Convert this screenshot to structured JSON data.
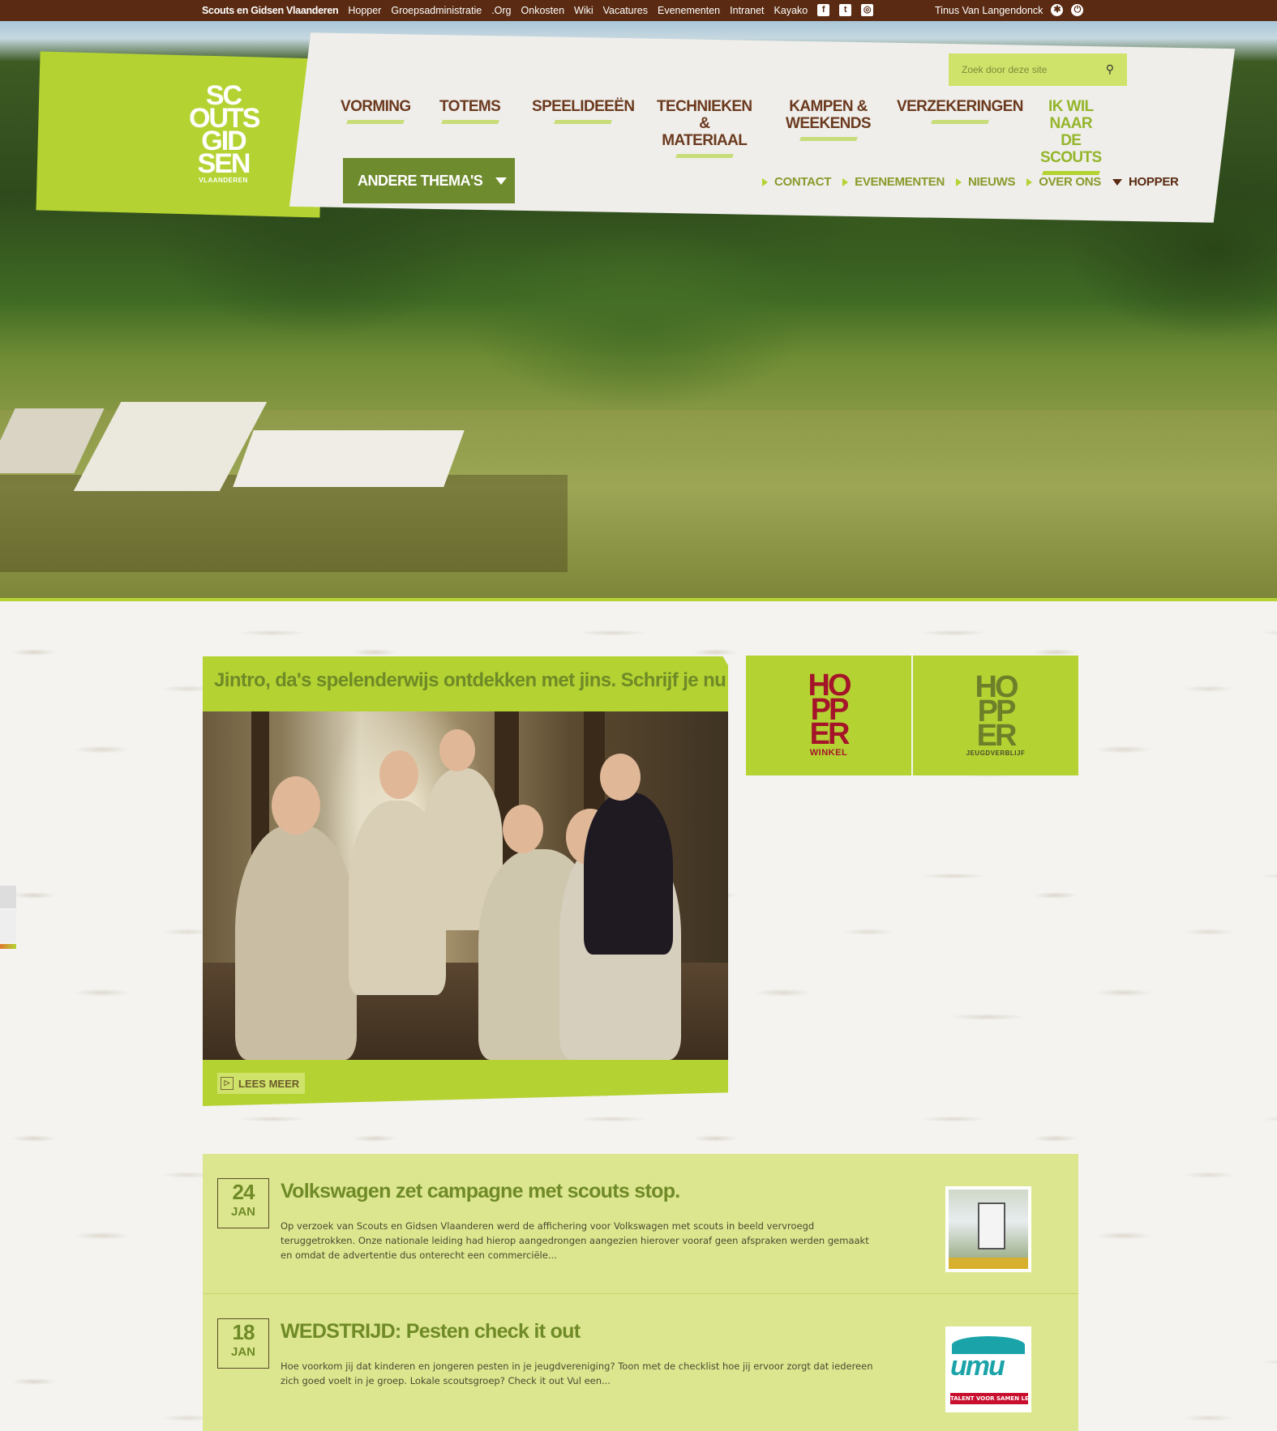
{
  "topbar": {
    "brand": "Scouts en Gidsen Vlaanderen",
    "links": [
      "Hopper",
      "Groepsadministratie",
      ".Org",
      "Onkosten",
      "Wiki",
      "Vacatures",
      "Evenementen",
      "Intranet",
      "Kayako"
    ],
    "social": [
      {
        "icon": "facebook-icon",
        "glyph": "f"
      },
      {
        "icon": "twitter-icon",
        "glyph": "t"
      },
      {
        "icon": "instagram-icon",
        "glyph": "◎"
      }
    ],
    "user_name": "Tinus Van Langendonck",
    "settings_glyph": "✱",
    "power_glyph": "⏻"
  },
  "logo": {
    "lines": [
      "SC",
      "OUTS",
      "GID",
      "SEN"
    ],
    "sub": "VLAANDEREN"
  },
  "search": {
    "placeholder": "Zoek door deze site",
    "icon": "search-icon",
    "glyph": "⚲"
  },
  "mainnav": [
    {
      "label": "VORMING"
    },
    {
      "label": "TOTEMS"
    },
    {
      "label": "SPEELIDEEËN"
    },
    {
      "label": "TECHNIEKEN\n& MATERIAAL"
    },
    {
      "label": "KAMPEN &\nWEEKENDS"
    },
    {
      "label": "VERZEKERINGEN"
    },
    {
      "label": "IK WIL NAAR\nDE SCOUTS"
    }
  ],
  "themes": {
    "label": "ANDERE THEMA'S"
  },
  "subnav": [
    "CONTACT",
    "EVENEMENTEN",
    "NIEUWS",
    "OVER ONS",
    "HOPPER"
  ],
  "feature": {
    "title": "Jintro, da's spelenderwijs ontdekken met jins. Schrijf je nu in!",
    "more_label": "LEES MEER"
  },
  "hopper": [
    {
      "word": "HO\nPP\nER",
      "label": "WINKEL"
    },
    {
      "word": "HO\nPP\nER",
      "label": "JEUGDVERBLIJF"
    }
  ],
  "news": [
    {
      "day": "24",
      "month": "JAN",
      "title": "Volkswagen zet campagne met scouts stop.",
      "excerpt": "Op verzoek van Scouts en Gidsen Vlaanderen werd de affichering voor Volkswagen met scouts in beeld vervroegd teruggetrokken. Onze nationale leiding had hierop aangedrongen aangezien hierover vooraf geen afspraken werden gemaakt en omdat de advertentie dus onterecht een commerciële..."
    },
    {
      "day": "18",
      "month": "JAN",
      "title": "WEDSTRIJD: Pesten check it out",
      "excerpt": "Hoe voorkom jij dat kinderen en jongeren pesten in je jeugdvereniging? Toon met de checklist hoe jij ervoor zorgt dat iedereen zich goed voelt in je groep. Lokale scoutsgroep? Check it out Vul een...",
      "thumb_logo": "umu",
      "thumb_tag": "TALENT VOOR SAMEN LEV"
    }
  ],
  "colors": {
    "brand_green": "#b4d333",
    "dark_brown": "#5a2b12",
    "text_green": "#6f8a26",
    "hopper_red": "#a5152a"
  }
}
